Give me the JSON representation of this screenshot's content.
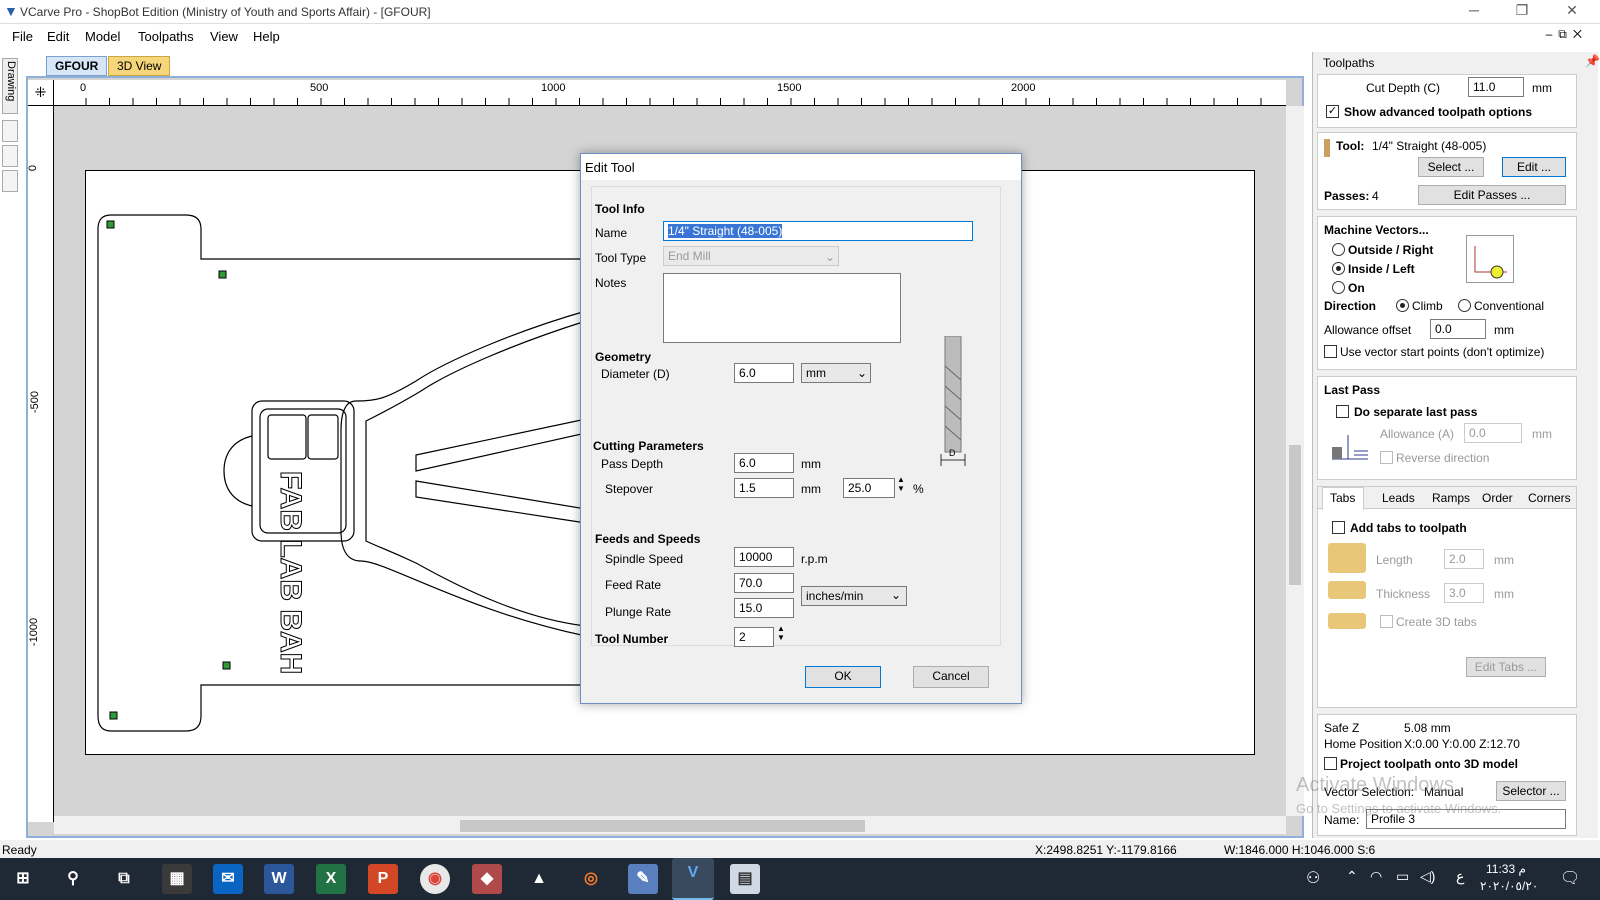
{
  "window": {
    "title": "VCarve Pro - ShopBot Edition (Ministry of Youth and Sports Affair) - [GFOUR]",
    "app_icon": "vcarve-logo-icon",
    "minimize": "─",
    "maximize": "❐",
    "close": "✕"
  },
  "menu": [
    "File",
    "Edit",
    "Model",
    "Toolpaths",
    "View",
    "Help"
  ],
  "side_tab": "Drawing",
  "tabs": [
    {
      "label": "GFOUR",
      "active": true
    },
    {
      "label": "3D View",
      "active": false
    }
  ],
  "ruler": {
    "h_labels": [
      "0",
      "500",
      "1000",
      "1500",
      "2000"
    ],
    "v_labels": [
      "0",
      "-500",
      "-1000"
    ]
  },
  "drawing_text": "FAB LAB BAH",
  "toolpaths_panel": {
    "title": "Toolpaths",
    "cut_depth_label": "Cut Depth (C)",
    "cut_depth_value": "11.0",
    "cut_depth_unit": "mm",
    "show_advanced_label": "Show advanced toolpath options",
    "show_advanced_checked": true,
    "tool_label": "Tool:",
    "tool_value": "1/4\" Straight  (48-005)",
    "select_btn": "Select ...",
    "edit_btn": "Edit ...",
    "passes_label": "Passes:",
    "passes_value": "4",
    "edit_passes_btn": "Edit Passes ...",
    "machine_vectors_label": "Machine Vectors...",
    "mv_options": [
      {
        "label": "Outside / Right",
        "on": false
      },
      {
        "label": "Inside / Left",
        "on": true
      },
      {
        "label": "On",
        "on": false
      }
    ],
    "direction_label": "Direction",
    "climb_label": "Climb",
    "conventional_label": "Conventional",
    "allowance_offset_label": "Allowance offset",
    "allowance_offset_value": "0.0",
    "allowance_offset_unit": "mm",
    "use_vector_start_label": "Use vector start points (don't optimize)",
    "last_pass_label": "Last Pass",
    "do_separate_label": "Do separate last pass",
    "allowance_a_label": "Allowance (A)",
    "allowance_a_value": "0.0",
    "allowance_a_unit": "mm",
    "reverse_direction_label": "Reverse direction",
    "subtabs": [
      "Tabs",
      "Leads",
      "Ramps",
      "Order",
      "Corners"
    ],
    "add_tabs_label": "Add tabs to toolpath",
    "length_label": "Length",
    "length_value": "2.0",
    "length_unit": "mm",
    "thickness_label": "Thickness",
    "thickness_value": "3.0",
    "thickness_unit": "mm",
    "create_3d_tabs_label": "Create 3D tabs",
    "edit_tabs_btn": "Edit Tabs ...",
    "safe_z_label": "Safe Z",
    "safe_z_value": "5.08 mm",
    "home_position_label": "Home Position",
    "home_position_value": "X:0.00 Y:0.00 Z:12.70",
    "project_label": "Project toolpath onto 3D model",
    "vector_selection_label": "Vector Selection:",
    "vector_selection_value": "Manual",
    "selector_btn": "Selector ...",
    "name_label": "Name:",
    "name_value": "Profile 3"
  },
  "dialog": {
    "title": "Edit Tool",
    "tool_info_label": "Tool Info",
    "name_label": "Name",
    "name_value": "1/4\" Straight  (48-005)",
    "tool_type_label": "Tool Type",
    "tool_type_value": "End Mill",
    "notes_label": "Notes",
    "notes_value": "",
    "geometry_label": "Geometry",
    "diameter_label": "Diameter (D)",
    "diameter_value": "6.0",
    "diameter_unit": "mm",
    "cutting_params_label": "Cutting Parameters",
    "pass_depth_label": "Pass Depth",
    "pass_depth_value": "6.0",
    "pass_depth_unit": "mm",
    "stepover_label": "Stepover",
    "stepover_value": "1.5",
    "stepover_unit": "mm",
    "stepover_pct_value": "25.0",
    "stepover_pct_unit": "%",
    "feeds_label": "Feeds and Speeds",
    "spindle_label": "Spindle Speed",
    "spindle_value": "10000",
    "spindle_unit": "r.p.m",
    "feed_label": "Feed Rate",
    "feed_value": "70.0",
    "plunge_label": "Plunge Rate",
    "plunge_value": "15.0",
    "rate_unit": "inches/min",
    "tool_number_label": "Tool Number",
    "tool_number_value": "2",
    "ok_btn": "OK",
    "cancel_btn": "Cancel",
    "diagram_label": "D"
  },
  "status": {
    "left": "Ready",
    "coords": "X:2498.8251 Y:-1179.8166",
    "size": "W:1846.000  H:1046.000  S:6"
  },
  "watermark": {
    "line1": "Activate Windows",
    "line2": "Go to Settings to activate Windows."
  },
  "taskbar": {
    "time": "11:33 م",
    "date": "٢٠٢٠/٠٥/٢٠",
    "lang": "ع",
    "apps": [
      "windows-start-icon",
      "search-icon",
      "task-view-icon",
      "store-icon",
      "mail-icon",
      "word-icon",
      "excel-icon",
      "powerpoint-icon",
      "chrome-icon",
      "app-icon",
      "inkscape-icon",
      "blender-icon",
      "paint-icon",
      "vcarve-icon",
      "explorer-icon"
    ]
  },
  "colors": {
    "accent": "#2a5db0",
    "selection": "#3875d7",
    "taskbar": "#1f2936"
  }
}
